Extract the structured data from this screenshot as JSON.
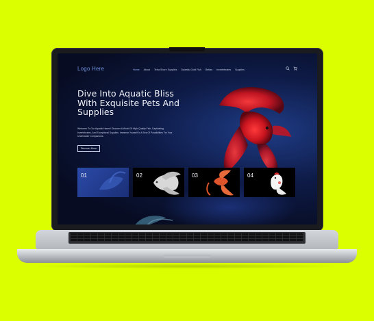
{
  "site": {
    "logo": "Logo Here",
    "menu": [
      "Home",
      "About",
      "Tetra Shore Supplies",
      "Daiarkio Gold Fish",
      "Bettas",
      "Invertebrates",
      "Supplies"
    ],
    "active_menu_index": 0
  },
  "hero": {
    "title": "Dive Into Aquatic Bliss With Exquisite Pets And Supplies",
    "description": "Welcome To Our Aquatic Haven! Discover A World Of High-Quality Fish, Captivating Invertebrates, And Exceptional Supplies. Immerse Yourself In A Sea Of Possibilities For Your Underwater Companions.",
    "cta_label": "Discover More"
  },
  "cards": [
    {
      "num": "01"
    },
    {
      "num": "02"
    },
    {
      "num": "03"
    },
    {
      "num": "04"
    }
  ],
  "icons": [
    "search-icon",
    "cart-icon"
  ],
  "colors": {
    "background": "#dcff00",
    "accent": "#6f8fd8",
    "fish_red": "#c8141f"
  }
}
